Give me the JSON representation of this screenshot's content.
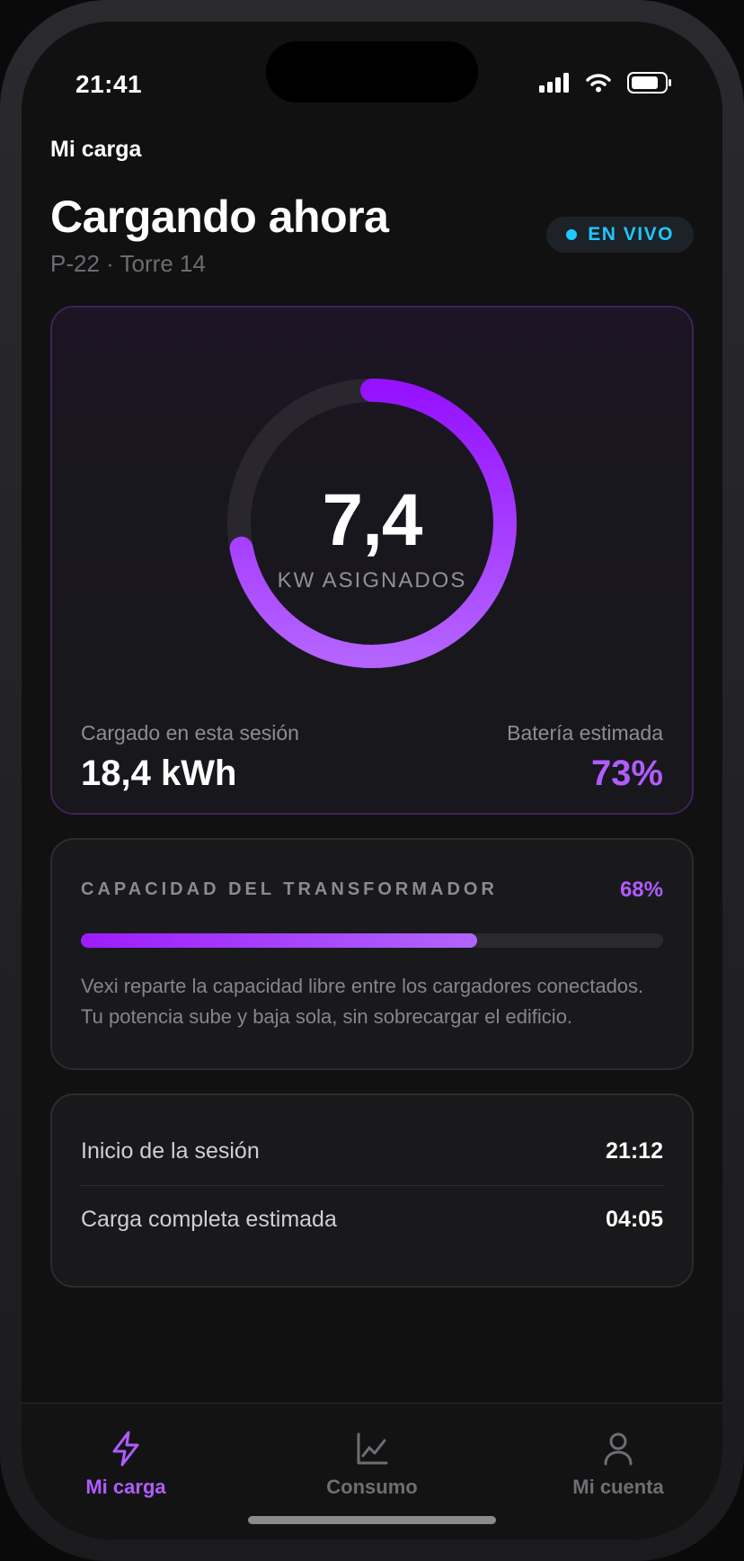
{
  "status_bar": {
    "time": "21:41"
  },
  "header": {
    "breadcrumb": "Mi carga",
    "title": "Cargando ahora",
    "location": "P-22 · Torre 14",
    "live_badge": "EN VIVO"
  },
  "power": {
    "value": "7,4",
    "unit_label": "KW ASIGNADOS",
    "gauge_fraction": 0.72,
    "session_label": "Cargado en esta sesión",
    "session_value": "18,4 kWh",
    "battery_label": "Batería estimada",
    "battery_value": "73%"
  },
  "transformer": {
    "title": "CAPACIDAD DEL TRANSFORMADOR",
    "percent_label": "68%",
    "fill_fraction": 0.68,
    "description": "Vexi reparte la capacidad libre entre los cargadores conectados. Tu potencia sube y baja sola, sin sobrecargar el edificio."
  },
  "session_times": {
    "start_label": "Inicio de la sesión",
    "start_value": "21:12",
    "end_label": "Carga completa estimada",
    "end_value": "04:05"
  },
  "tabs": [
    {
      "label": "Mi carga",
      "icon": "bolt-icon",
      "active": true
    },
    {
      "label": "Consumo",
      "icon": "chart-icon",
      "active": false
    },
    {
      "label": "Mi cuenta",
      "icon": "user-icon",
      "active": false
    }
  ],
  "colors": {
    "accent": "#9d1cff",
    "accent_light": "#b05cff",
    "live": "#1ec8ff",
    "background": "#111112"
  }
}
